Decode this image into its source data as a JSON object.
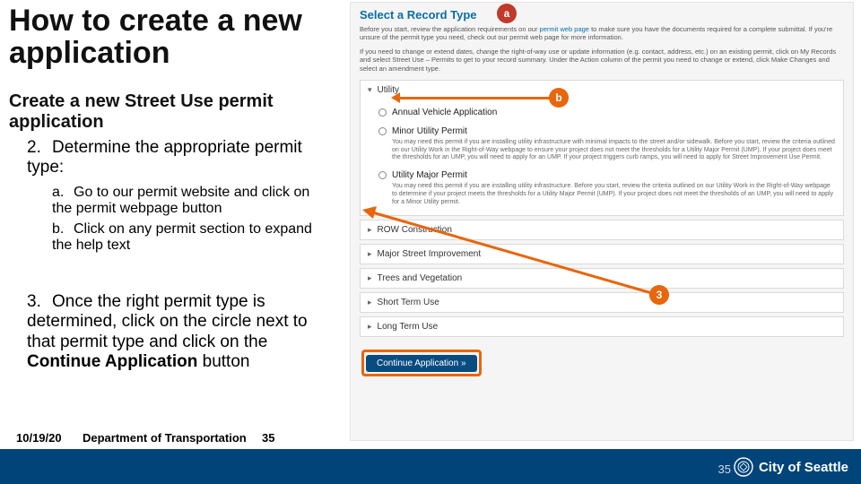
{
  "title": "How to create a new application",
  "subtitle": "Create a new Street Use permit application",
  "step2": {
    "num": "2.",
    "text": "Determine the appropriate permit type:"
  },
  "sub": {
    "a": {
      "let": "a.",
      "text": "Go to our permit website and click on the permit webpage button"
    },
    "b": {
      "let": "b.",
      "text": "Click on any permit section to expand the help text"
    }
  },
  "step3": {
    "num": "3.",
    "prefix": "Once the right permit type is determined, click on the circle next to that permit type and click on the ",
    "bold": "Continue Application",
    "suffix": " button"
  },
  "footer": {
    "date": "10/19/20",
    "dept": "Department of Transportation",
    "page_left": "35",
    "page_right": "35",
    "logo_text": "City of Seattle"
  },
  "panel": {
    "heading": "Select a Record Type",
    "blurb1_a": "Before you start, review the application requirements on our ",
    "blurb1_link": "permit web page",
    "blurb1_b": " to make sure you have the documents required for a complete submittal. If you're unsure of the permit type you need, check out our permit web page for more information.",
    "blurb2": "If you need to change or extend dates, change the right-of-way use or update information (e.g. contact, address, etc.) on an existing permit, click on My Records and select Street Use – Permits to get to your record summary. Under the Action column of the permit you need to change or extend, click Make Changes and select an amendment type.",
    "utility": {
      "label": "Utility",
      "annual": "Annual Vehicle Application",
      "minor": {
        "label": "Minor Utility Permit",
        "desc": "You may need this permit if you are installing utility infrastructure with minimal impacts to the street and/or sidewalk. Before you start, review the criteria outlined on our Utility Work in the Right-of-Way webpage to ensure your project does not meet the thresholds for a Utility Major Permit (UMP). If your project does meet the thresholds for an UMP, you will need to apply for an UMP. If your project triggers curb ramps, you will need to apply for Street Improvement Use Permit."
      },
      "major": {
        "label": "Utility Major Permit",
        "desc": "You may need this permit if you are installing utility infrastructure. Before you start, review the criteria outlined on our Utility Work in the Right-of-Way webpage to determine if your project meets the thresholds for a Utility Major Permit (UMP). If your project does not meet the thresholds of an UMP, you will need to apply for a Minor Utility permit."
      }
    },
    "sections": {
      "row": "ROW Construction",
      "msi": "Major Street Improvement",
      "tv": "Trees and Vegetation",
      "stu": "Short Term Use",
      "ltu": "Long Term Use"
    },
    "continue": "Continue Application »"
  },
  "callouts": {
    "a": "a",
    "b": "b",
    "three": "3"
  }
}
